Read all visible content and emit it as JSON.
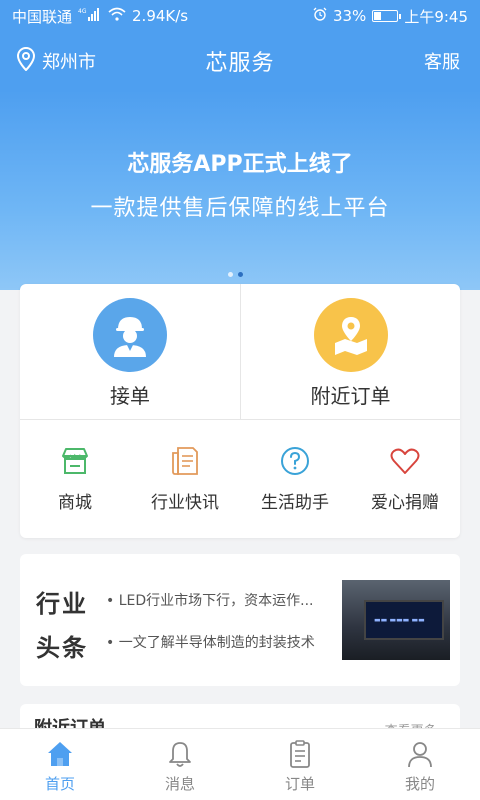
{
  "status_bar": {
    "carrier": "中国联通",
    "network": "4G",
    "speed": "2.94K/s",
    "battery": "33%",
    "time": "上午9:45",
    "battery_level": 0.33
  },
  "header": {
    "location": "郑州市",
    "title": "芯服务",
    "service": "客服"
  },
  "banner": {
    "title": "芯服务APP正式上线了",
    "subtitle": "一款提供售后保障的线上平台"
  },
  "main_actions": [
    {
      "label": "接单",
      "icon": "worker-icon",
      "color": "#5aa6ea"
    },
    {
      "label": "附近订单",
      "icon": "map-pin-icon",
      "color": "#f8c34a"
    }
  ],
  "quick_actions": [
    {
      "label": "商城",
      "icon": "shop-icon",
      "color": "#4cb86a"
    },
    {
      "label": "行业快讯",
      "icon": "document-icon",
      "color": "#e29a5b"
    },
    {
      "label": "生活助手",
      "icon": "question-icon",
      "color": "#3aa3d8"
    },
    {
      "label": "爱心捐赠",
      "icon": "heart-icon",
      "color": "#d8453d"
    }
  ],
  "news": {
    "tag_line1": "行业",
    "tag_line2": "头条",
    "items": [
      "LED行业市场下行，资本运作...",
      "一文了解半导体制造的封装技术"
    ],
    "thumbnail": "led-screen-photo"
  },
  "nearby": {
    "title": "附近订单",
    "more": "查看更多"
  },
  "tabs": [
    {
      "label": "首页",
      "icon": "home-icon",
      "active": true
    },
    {
      "label": "消息",
      "icon": "bell-icon",
      "active": false
    },
    {
      "label": "订单",
      "icon": "clipboard-icon",
      "active": false
    },
    {
      "label": "我的",
      "icon": "user-icon",
      "active": false
    }
  ],
  "colors": {
    "primary": "#4e9ff0",
    "background": "#f2f3f5"
  }
}
